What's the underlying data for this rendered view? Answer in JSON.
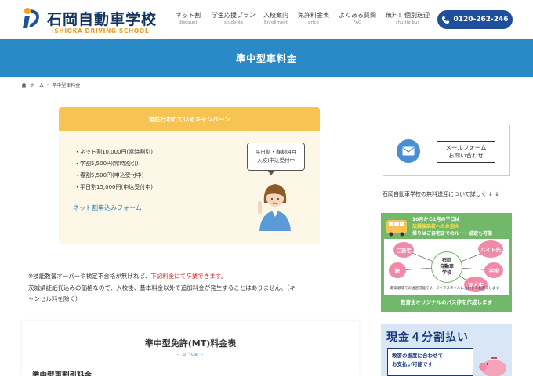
{
  "header": {
    "logo_jp": "石岡自動車学校",
    "logo_en": "ISHIOKA DRIVING SCHOOL",
    "nav": [
      {
        "label": "ネット割",
        "sub": "discount"
      },
      {
        "label": "学生応援プラン",
        "sub": "students"
      },
      {
        "label": "入校案内",
        "sub": "Enrollment"
      },
      {
        "label": "免許料金表",
        "sub": "price"
      },
      {
        "label": "よくある質問",
        "sub": "FAQ"
      },
      {
        "label": "無料！個別送迎",
        "sub": "shuttle bus"
      }
    ],
    "tel": "0120-262-246",
    "tel_icon": "phone-icon"
  },
  "page_title": "準中型車料金",
  "breadcrumb": {
    "home": "ホーム",
    "current": "準中型車料金"
  },
  "campaign": {
    "heading": "現在行われているキャンペーン",
    "items": [
      "・ネット割10,000円(常時割引)",
      "・学割5,500円(常時割引)",
      "・春割5,500円(申込受付中)",
      "・平日割15,000円(申込受付中)"
    ],
    "link": "ネット割申込みフォーム",
    "speech_line1": "平日割・春割(4月",
    "speech_line2": "入校)申込受付中"
  },
  "note": {
    "line1_prefix": "※技能教習オーバーや検定不合格が無ければ、",
    "line1_red": "下記料金にて卒業できます。",
    "line2": "茨城県証紙代込みの価格なので、入校後、基本料金以外で追加料金が発生することはありません。（キ",
    "line3": "ャンセル料を除く）"
  },
  "price": {
    "title": "準中型免許(MT)料金表",
    "sub": "– price –",
    "h3": "準中型車割引料金"
  },
  "sidebar": {
    "mail_line1": "メールフォーム",
    "mail_line2": "お問い合わせ",
    "shuttle_text": "石岡自動車学校の無料送迎について詳しく ↓ ↓",
    "bus": {
      "top_line1": "10月から1月の平日は",
      "top_line2": "放課後高校へのお迎え",
      "top_line3": "帰りはご自宅までのルート設定も可能",
      "center": "石岡\n自動車\n学校",
      "nodes": [
        "ご自宅",
        "バイト先",
        "駅",
        "学校",
        "友人宅"
      ],
      "map_note": "最寄駅等での送迎可能です。ライフスタイルに合わせてお迎えします",
      "bottom": "教習生オリジナルのバス停を作成します"
    },
    "pay": {
      "title": "現金４分割払い",
      "line1": "教習の進度に合わせて",
      "line2": "お支払い可能です"
    }
  },
  "colors": {
    "brand_blue": "#1d4f9b",
    "title_band": "#2a8ac8",
    "campaign_head": "#f7c453",
    "red": "#e02020",
    "bus_green": "#72b86a"
  }
}
